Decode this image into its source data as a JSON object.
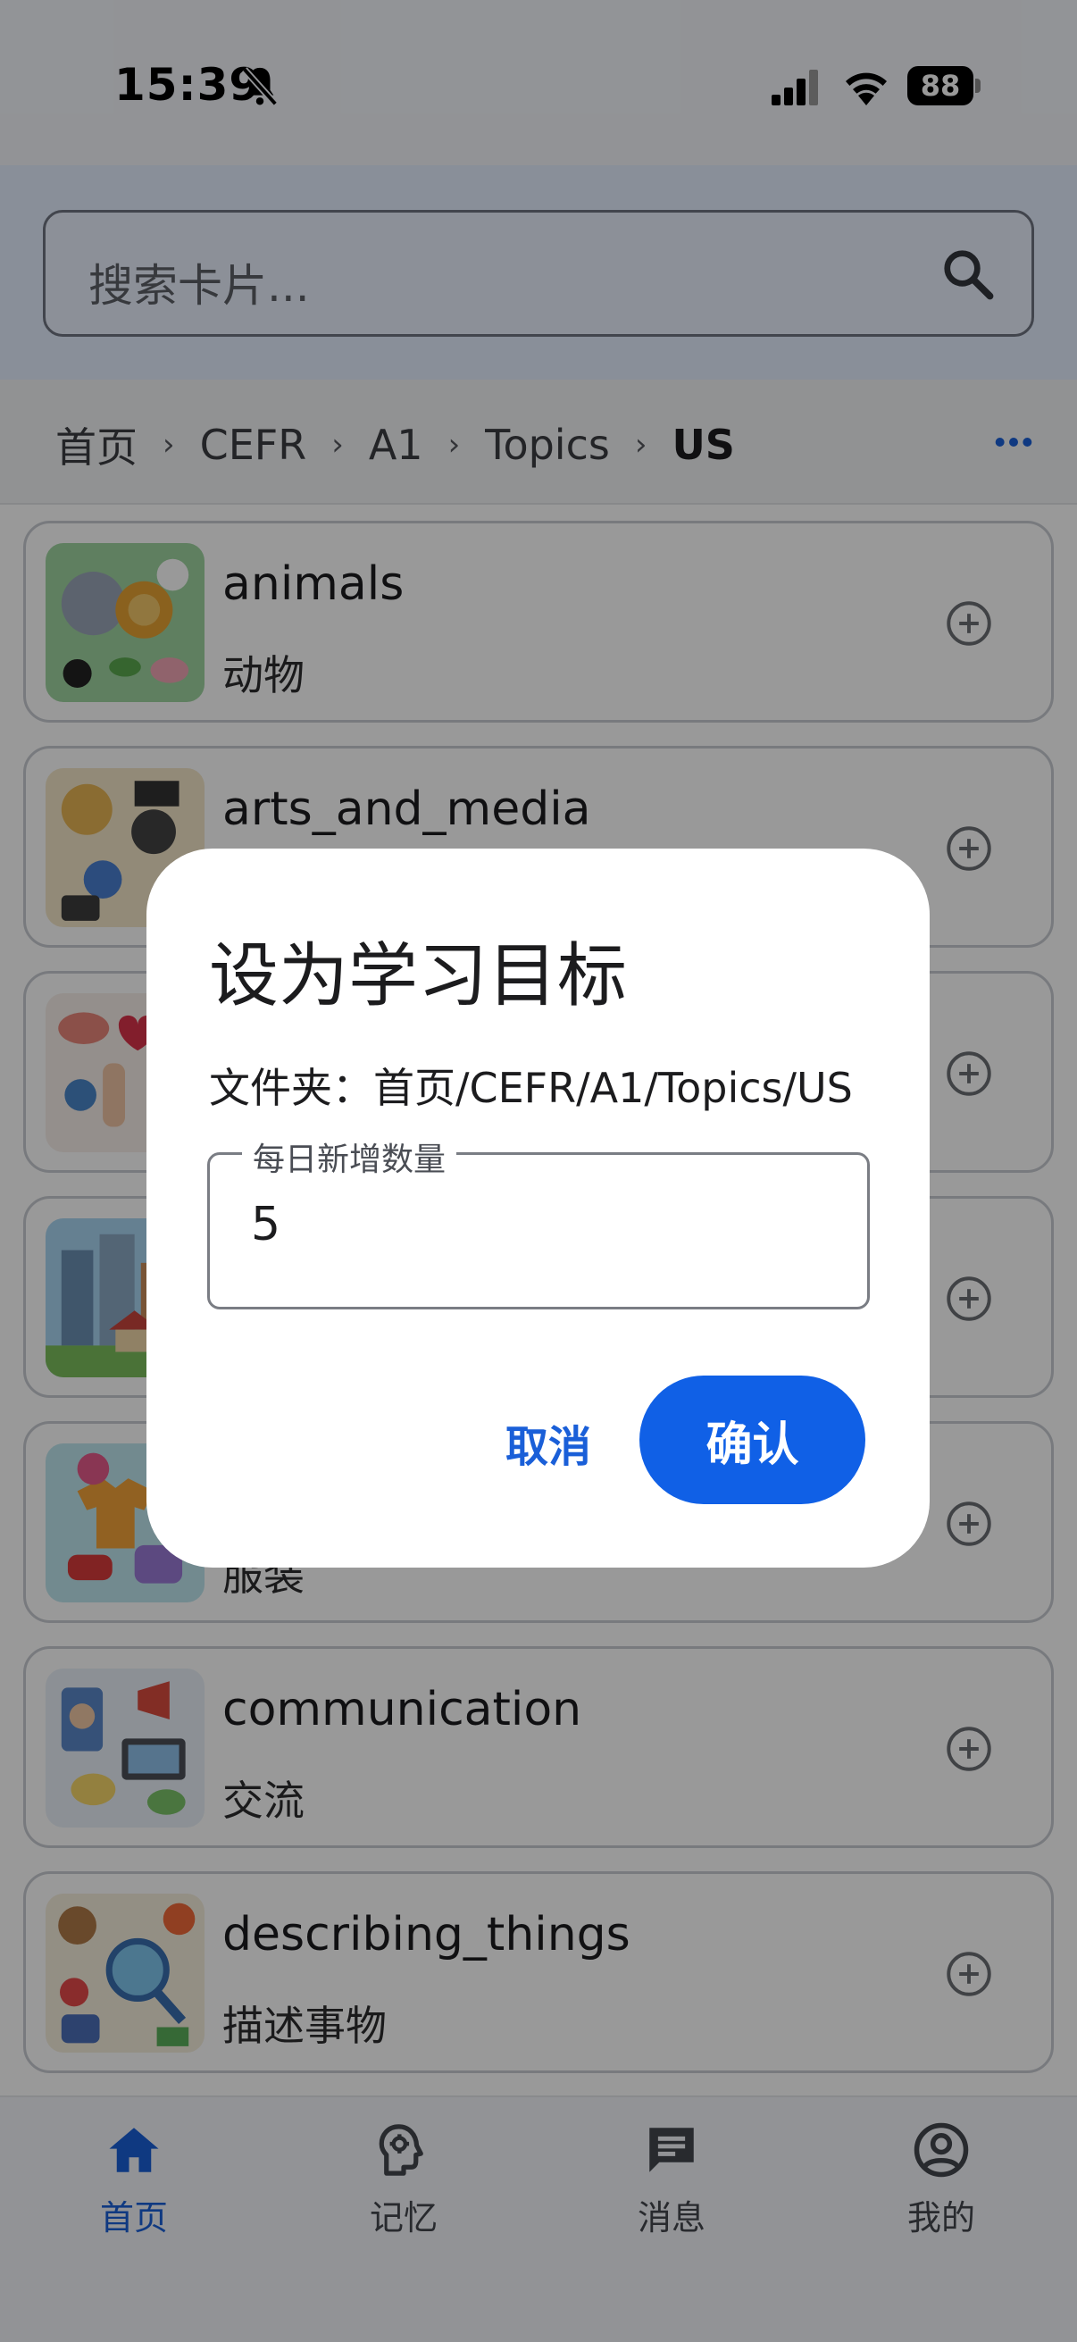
{
  "status_bar": {
    "time": "15:39",
    "battery": "88"
  },
  "search": {
    "placeholder": "搜索卡片..."
  },
  "breadcrumb": {
    "items": [
      "首页",
      "CEFR",
      "A1",
      "Topics",
      "US"
    ]
  },
  "cards": [
    {
      "title": "animals",
      "subtitle": "动物"
    },
    {
      "title": "arts_and_media",
      "subtitle": ""
    },
    {
      "title": "",
      "subtitle": ""
    },
    {
      "title": "",
      "subtitle": ""
    },
    {
      "title": "",
      "subtitle": "服装"
    },
    {
      "title": "communication",
      "subtitle": "交流"
    },
    {
      "title": "describing_things",
      "subtitle": "描述事物"
    }
  ],
  "bottom_nav": [
    {
      "label": "首页",
      "icon": "home-icon",
      "active": true
    },
    {
      "label": "记忆",
      "icon": "brain-head-icon",
      "active": false
    },
    {
      "label": "消息",
      "icon": "message-icon",
      "active": false
    },
    {
      "label": "我的",
      "icon": "profile-icon",
      "active": false
    }
  ],
  "dialog": {
    "title": "设为学习目标",
    "folder_text": "文件夹：首页/CEFR/A1/Topics/US",
    "field_label": "每日新增数量",
    "field_value": "5",
    "cancel_label": "取消",
    "confirm_label": "确认"
  },
  "colors": {
    "accent": "#1060e6",
    "active_nav": "#1a5fd8",
    "search_bg": "#e5efff"
  }
}
